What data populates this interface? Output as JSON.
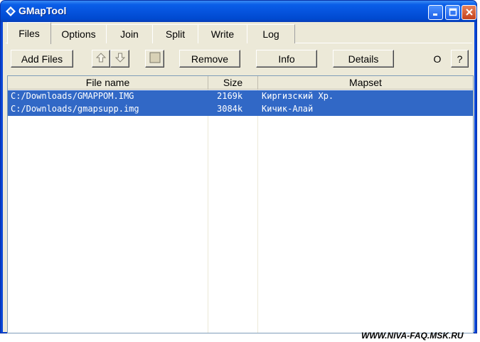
{
  "window": {
    "title": "GMapTool",
    "icon": "diamond-icon",
    "controls": [
      "minimize-icon",
      "maximize-icon",
      "close-icon"
    ]
  },
  "tabs": [
    {
      "label": "Files",
      "active": true
    },
    {
      "label": "Options",
      "active": false
    },
    {
      "label": "Join",
      "active": false
    },
    {
      "label": "Split",
      "active": false
    },
    {
      "label": "Write",
      "active": false
    },
    {
      "label": "Log",
      "active": false
    }
  ],
  "toolbar": {
    "add_files": "Add Files",
    "move_up_icon": "arrow-up-icon",
    "move_down_icon": "arrow-down-icon",
    "stop_icon": "square-icon",
    "remove": "Remove",
    "info": "Info",
    "details": "Details",
    "circle": "O",
    "help": "?"
  },
  "table": {
    "columns": [
      "File name",
      "Size",
      "Mapset"
    ],
    "rows": [
      {
        "file": "C:/Downloads/GMAPPOM.IMG",
        "size": "2169k",
        "mapset": "Киргизский Хр.",
        "selected": true
      },
      {
        "file": "C:/Downloads/gmapsupp.img",
        "size": "3084k",
        "mapset": "Кичик-Алай",
        "selected": true
      }
    ]
  },
  "watermark": "WWW.NIVA-FAQ.MSK.RU",
  "colors": {
    "titlebar": "#0054e3",
    "selection": "#3168c6",
    "face": "#ece9d8"
  }
}
